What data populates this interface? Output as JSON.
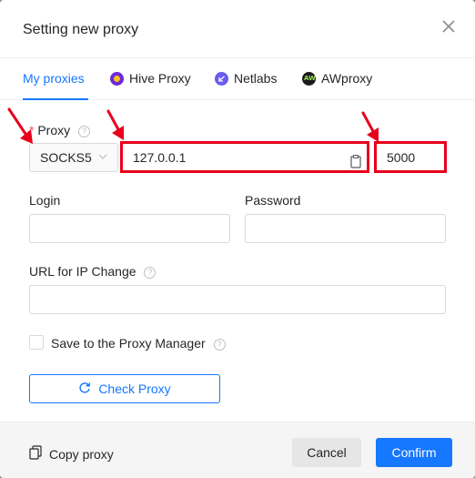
{
  "modal": {
    "title": "Setting new proxy",
    "background_peek_text": "· ·· ·· ·· ·· ··· ·· ·· ··· ·"
  },
  "tabs": [
    {
      "label": "My proxies",
      "icon": "none",
      "active": true
    },
    {
      "label": "Hive Proxy",
      "icon": "hive-proxy-icon",
      "active": false
    },
    {
      "label": "Netlabs",
      "icon": "netlabs-icon",
      "active": false
    },
    {
      "label": "AWproxy",
      "icon": "awproxy-icon",
      "active": false
    }
  ],
  "proxy": {
    "required_mark": "*",
    "label": "Proxy",
    "type_value": "SOCKS5",
    "host_value": "127.0.0.1",
    "port_value": "5000"
  },
  "login": {
    "label": "Login",
    "value": ""
  },
  "password": {
    "label": "Password",
    "value": ""
  },
  "ip_change": {
    "label": "URL for IP Change",
    "value": ""
  },
  "save_manager": {
    "label": "Save to the Proxy Manager",
    "checked": false
  },
  "check_proxy": {
    "label": "Check Proxy"
  },
  "footer": {
    "copy_proxy_label": "Copy proxy",
    "cancel_label": "Cancel",
    "confirm_label": "Confirm"
  },
  "colors": {
    "accent": "#1677ff",
    "highlight": "#e8001c",
    "required": "#ff4d4f"
  }
}
